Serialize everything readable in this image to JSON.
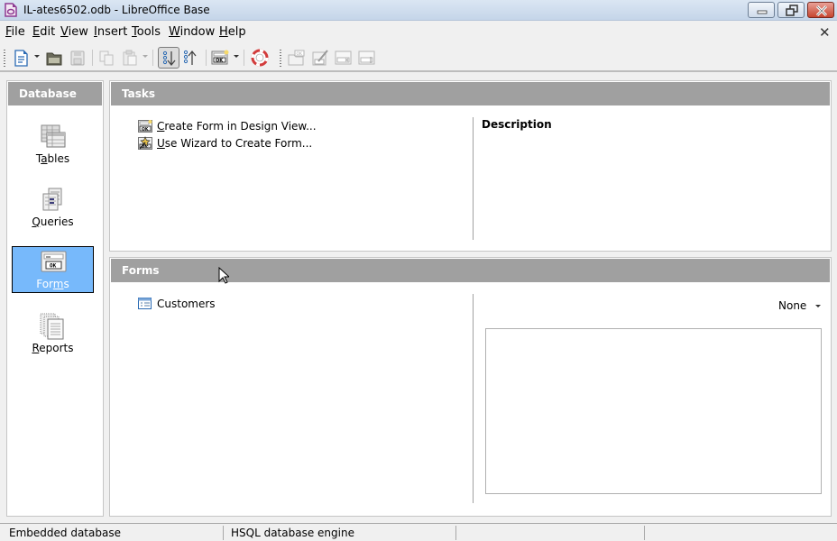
{
  "window": {
    "title": "IL-ates6502.odb - LibreOffice Base",
    "controls": [
      "minimize",
      "restore",
      "close"
    ]
  },
  "menubar": {
    "items": [
      {
        "label": "File",
        "mnemonic": "F",
        "rest": "ile"
      },
      {
        "label": "Edit",
        "mnemonic": "E",
        "rest": "dit"
      },
      {
        "label": "View",
        "mnemonic": "V",
        "rest": "iew"
      },
      {
        "label": "Insert",
        "mnemonic": "I",
        "rest": "nsert"
      },
      {
        "label": "Tools",
        "mnemonic": "T",
        "rest": "ools"
      },
      {
        "label": "Window",
        "mnemonic": "W",
        "rest": "indow"
      },
      {
        "label": "Help",
        "mnemonic": "H",
        "rest": "elp"
      }
    ],
    "close_document": "✕"
  },
  "toolbar": {
    "items": [
      {
        "name": "new-document",
        "enabled": true
      },
      {
        "name": "open",
        "enabled": true
      },
      {
        "name": "save",
        "enabled": false
      },
      {
        "name": "copy",
        "enabled": false
      },
      {
        "name": "paste",
        "enabled": false
      },
      {
        "name": "sort-ascending",
        "enabled": true,
        "active": true
      },
      {
        "name": "sort-descending",
        "enabled": true
      },
      {
        "name": "form",
        "enabled": true
      },
      {
        "name": "help",
        "enabled": true
      },
      {
        "name": "open-form",
        "enabled": false
      },
      {
        "name": "edit-form",
        "enabled": false
      },
      {
        "name": "delete-form",
        "enabled": false
      },
      {
        "name": "rename-form",
        "enabled": false
      }
    ]
  },
  "database_panel": {
    "title": "Database",
    "items": [
      {
        "label_pre": "T",
        "mnemonic": "a",
        "label_post": "bles",
        "label": "Tables",
        "selected": false
      },
      {
        "label_pre": "",
        "mnemonic": "Q",
        "label_post": "ueries",
        "label": "Queries",
        "selected": false
      },
      {
        "label_pre": "For",
        "mnemonic": "m",
        "label_post": "s",
        "label": "Forms",
        "selected": true
      },
      {
        "label_pre": "",
        "mnemonic": "R",
        "label_post": "eports",
        "label": "Reports",
        "selected": false
      }
    ]
  },
  "tasks_panel": {
    "title": "Tasks",
    "items": [
      {
        "mnemonic": "C",
        "rest": "reate Form in Design View...",
        "label": "Create Form in Design View..."
      },
      {
        "mnemonic": "U",
        "rest": "se Wizard to Create Form...",
        "label": "Use Wizard to Create Form..."
      }
    ],
    "description_title": "Description"
  },
  "forms_panel": {
    "title": "Forms",
    "items": [
      {
        "label": "Customers"
      }
    ],
    "preview_mode": "None"
  },
  "statusbar": {
    "cells": [
      "Embedded database",
      "HSQL database engine",
      "",
      ""
    ]
  },
  "colors": {
    "panel_header": "#a0a0a0",
    "selection": "#77b9fb",
    "close_button": "#c6452f"
  }
}
